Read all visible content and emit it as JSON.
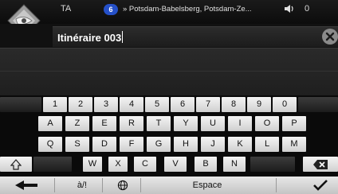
{
  "status": {
    "left_label": "TA",
    "route_badge": "6",
    "street": "» Potsdam-Babelsberg, Potsdam-Ze...",
    "count": "0"
  },
  "input": {
    "value": "Itinéraire 003"
  },
  "keyboard": {
    "row1": [
      "1",
      "2",
      "3",
      "4",
      "5",
      "6",
      "7",
      "8",
      "9",
      "0"
    ],
    "row2": [
      "A",
      "Z",
      "E",
      "R",
      "T",
      "Y",
      "U",
      "I",
      "O",
      "P"
    ],
    "row3": [
      "Q",
      "S",
      "D",
      "F",
      "G",
      "H",
      "J",
      "K",
      "L",
      "M"
    ],
    "row4": [
      "W",
      "X",
      "C",
      "V",
      "B",
      "N"
    ],
    "symbols_label": "à/!",
    "space_label": "Espace"
  },
  "colors": {
    "accent_badge": "#2550c8",
    "key_face": "#e8e8e8",
    "background": "#000000"
  }
}
